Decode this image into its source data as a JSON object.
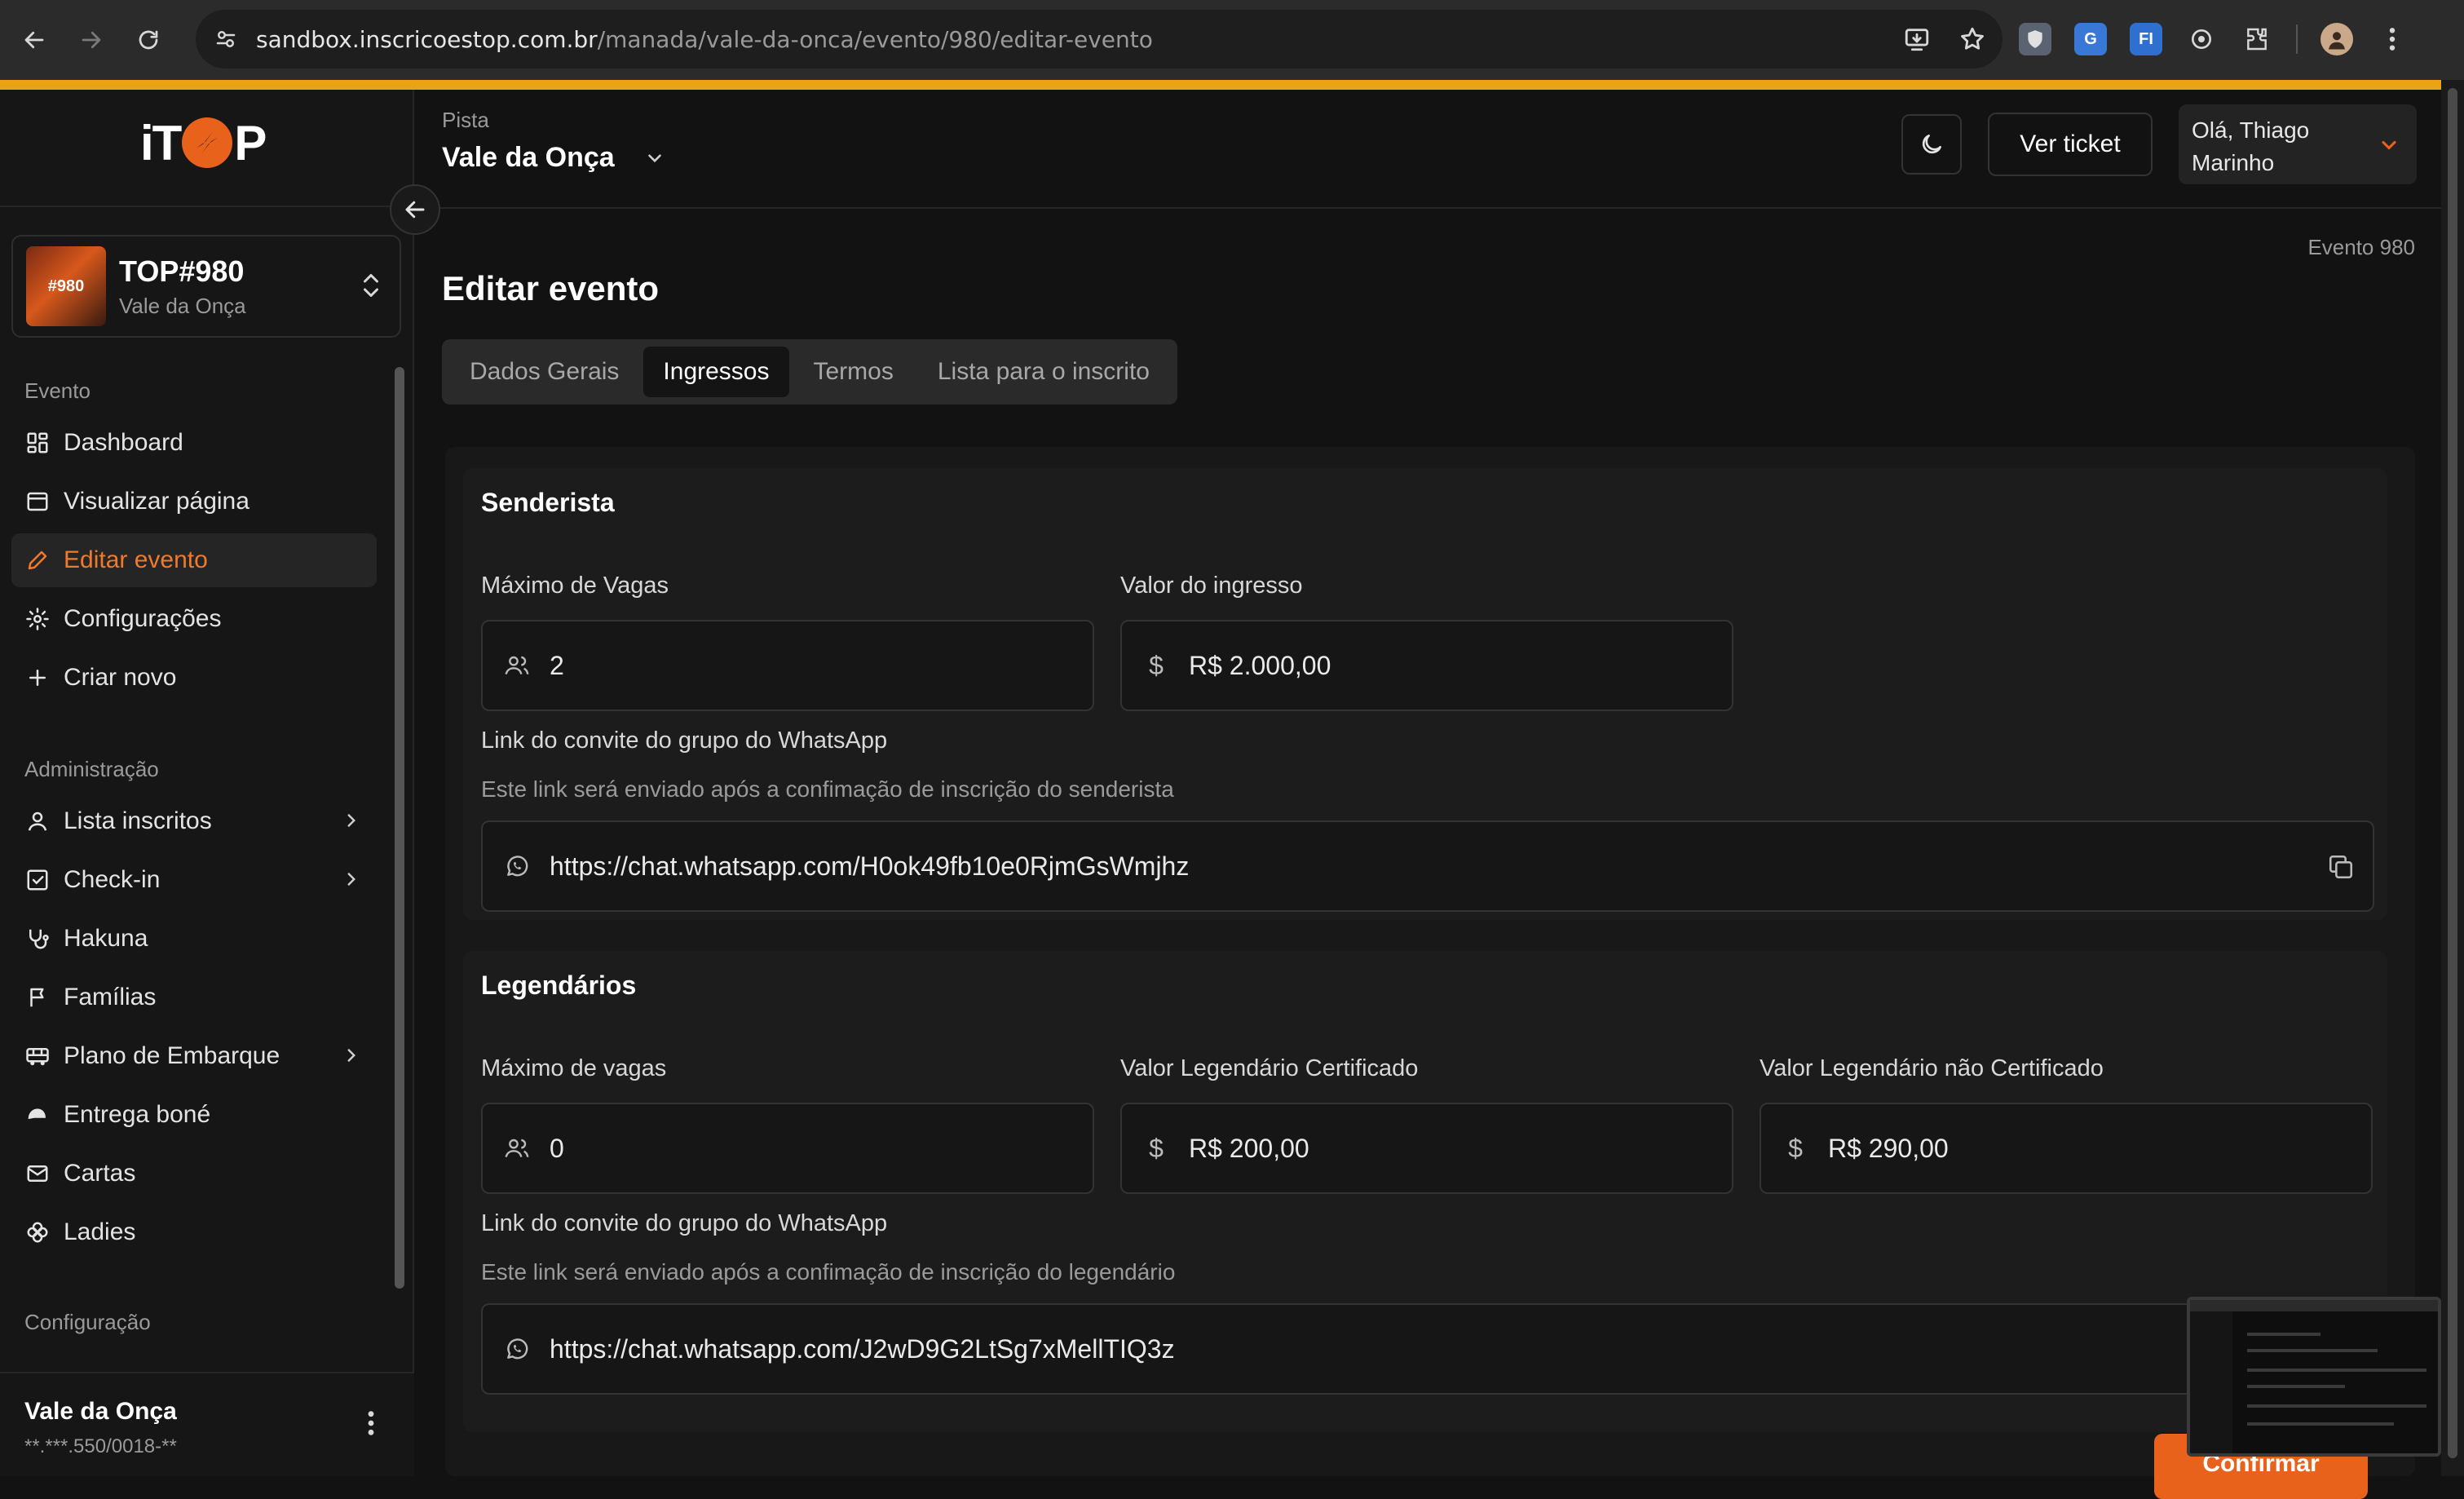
{
  "browser": {
    "url_host": "sandbox.inscricoestop.com.br",
    "url_path": "/manada/vale-da-onca/evento/980/editar-evento"
  },
  "app": {
    "logo_left": "iT",
    "logo_right": "P"
  },
  "sidebar": {
    "event_card": {
      "thumb_label": "#980",
      "title": "TOP#980",
      "subtitle": "Vale da Onça"
    },
    "section_evento": "Evento",
    "evento_items": [
      {
        "label": "Dashboard",
        "icon": "dashboard-icon"
      },
      {
        "label": "Visualizar página",
        "icon": "page-icon"
      },
      {
        "label": "Editar evento",
        "icon": "pencil-icon",
        "active": true
      },
      {
        "label": "Configurações",
        "icon": "gear-icon"
      },
      {
        "label": "Criar novo",
        "icon": "plus-icon"
      }
    ],
    "section_admin": "Administração",
    "admin_items": [
      {
        "label": "Lista inscritos",
        "icon": "user-icon",
        "chevron": true
      },
      {
        "label": "Check-in",
        "icon": "checkbox-icon",
        "chevron": true
      },
      {
        "label": "Hakuna",
        "icon": "stethoscope-icon"
      },
      {
        "label": "Famílias",
        "icon": "flag-icon"
      },
      {
        "label": "Plano de Embarque",
        "icon": "bus-icon",
        "chevron": true
      },
      {
        "label": "Entrega boné",
        "icon": "cap-icon"
      },
      {
        "label": "Cartas",
        "icon": "mail-icon"
      },
      {
        "label": "Ladies",
        "icon": "flower-icon"
      }
    ],
    "section_config": "Configuração",
    "footer": {
      "name": "Vale da Onça",
      "doc": "**.***.550/0018-**"
    }
  },
  "header": {
    "pista_label": "Pista",
    "pista_value": "Vale da Onça",
    "ticket_button": "Ver ticket",
    "user_line1": "Olá, Thiago",
    "user_line2": "Marinho"
  },
  "main": {
    "breadcrumb": "Evento 980",
    "title": "Editar evento",
    "tabs": [
      "Dados Gerais",
      "Ingressos",
      "Termos",
      "Lista para o inscrito"
    ],
    "active_tab": "Ingressos",
    "senderista": {
      "title": "Senderista",
      "max_label": "Máximo de Vagas",
      "max_value": "2",
      "price_label": "Valor do ingresso",
      "price_value": "R$ 2.000,00",
      "link_label": "Link do convite do grupo do WhatsApp",
      "link_help": "Este link será enviado após a confimação de inscrição do senderista",
      "link_value": "https://chat.whatsapp.com/H0ok49fb10e0RjmGsWmjhz"
    },
    "legendarios": {
      "title": "Legendários",
      "max_label": "Máximo de vagas",
      "max_value": "0",
      "cert_label": "Valor Legendário Certificado",
      "cert_value": "R$ 200,00",
      "noncert_label": "Valor Legendário não Certificado",
      "noncert_value": "R$ 290,00",
      "link_label": "Link do convite do grupo do WhatsApp",
      "link_help": "Este link será enviado após a confimação de inscrição do legendário",
      "link_value": "https://chat.whatsapp.com/J2wD9G2LtSg7xMellTIQ3z"
    },
    "currency_symbol": "$",
    "confirm_button": "Confirmar"
  },
  "colors": {
    "accent": "#e8621c",
    "strip": "#e8a317",
    "background": "#121212"
  }
}
